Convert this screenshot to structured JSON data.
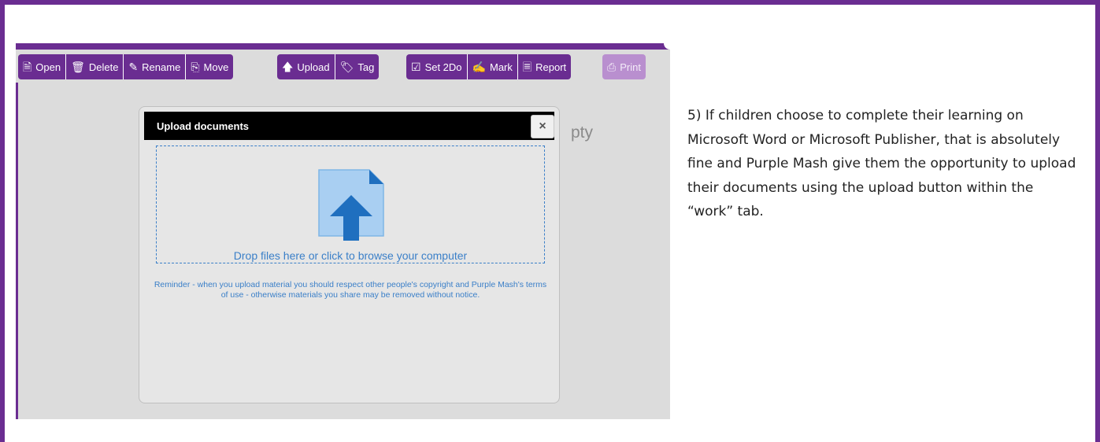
{
  "colors": {
    "brand_purple": "#6a2d91",
    "link_blue": "#3a7fc8",
    "upload_icon_blue": "#1f6fbf",
    "upload_icon_light": "#a9cff2"
  },
  "toolbar": {
    "groups": [
      [
        {
          "label": "Open",
          "icon": "file-icon",
          "glyph": "🗎"
        },
        {
          "label": "Delete",
          "icon": "trash-icon",
          "glyph": "🗑"
        },
        {
          "label": "Rename",
          "icon": "pencil-icon",
          "glyph": "✎"
        },
        {
          "label": "Move",
          "icon": "move-file-icon",
          "glyph": "⎘"
        }
      ],
      [
        {
          "label": "Upload",
          "icon": "upload-arrow-icon",
          "glyph": "🡅"
        },
        {
          "label": "Tag",
          "icon": "tag-icon",
          "glyph": "🏷"
        }
      ],
      [
        {
          "label": "Set 2Do",
          "icon": "clipboard-check-icon",
          "glyph": "☑"
        },
        {
          "label": "Mark",
          "icon": "marker-icon",
          "glyph": "✍"
        },
        {
          "label": "Report",
          "icon": "report-icon",
          "glyph": "🗏"
        }
      ],
      [
        {
          "label": "Print",
          "icon": "printer-icon",
          "glyph": "⎙",
          "disabled": true
        }
      ]
    ]
  },
  "background_text": "pty",
  "modal": {
    "title": "Upload documents",
    "close_label": "×",
    "dropzone_text": "Drop files here or click to browse your computer",
    "upload_icon": "file-upload-icon",
    "reminder": "Reminder - when you upload material you should respect other people's copyright and Purple Mash's terms of use - otherwise materials you share may be removed without notice."
  },
  "description": "5) If children choose to complete their learning on Microsoft Word or Microsoft Publisher, that is absolutely fine and Purple Mash give them the opportunity to upload their documents using the upload button within the “work” tab."
}
